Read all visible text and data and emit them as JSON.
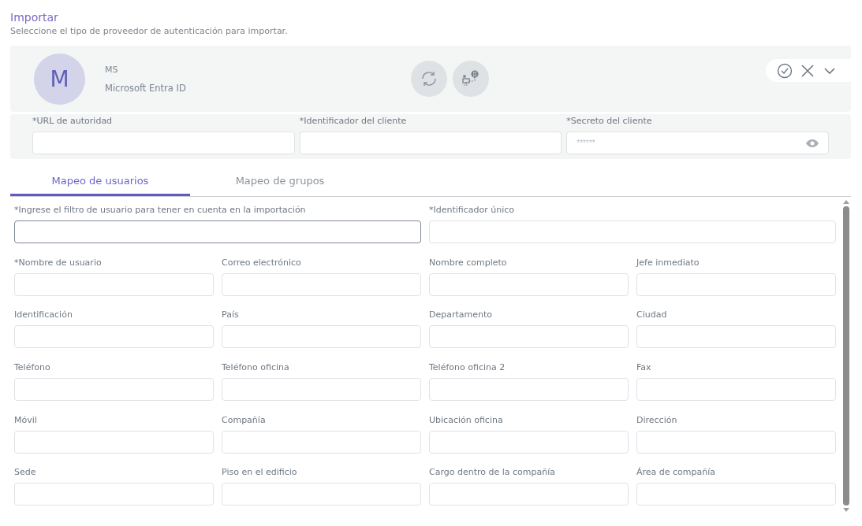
{
  "header": {
    "title": "Importar",
    "subtitle": "Seleccione el tipo de proveedor de autenticación para importar."
  },
  "provider": {
    "avatar_letter": "M",
    "code": "MS",
    "name": "Microsoft Entra ID"
  },
  "credentials": [
    {
      "label": "*URL de autoridad",
      "kind": "text"
    },
    {
      "label": "*Identificador del cliente",
      "kind": "text"
    },
    {
      "label": "*Secreto del cliente",
      "kind": "password",
      "placeholder": "******"
    }
  ],
  "tabs": [
    {
      "label": "Mapeo de usuarios",
      "selected": true
    },
    {
      "label": "Mapeo de grupos",
      "selected": false
    }
  ],
  "fields": [
    {
      "label": "*Ingrese el filtro de usuario para tener en cuenta en la importación",
      "wide": true,
      "focused": true
    },
    {
      "label": "*Identificador único",
      "wide": true,
      "focused": false
    },
    {
      "label": "*Nombre de usuario",
      "wide": false,
      "focused": false
    },
    {
      "label": "Correo electrónico",
      "wide": false,
      "focused": false
    },
    {
      "label": "Nombre completo",
      "wide": false,
      "focused": false
    },
    {
      "label": "Jefe inmediato",
      "wide": false,
      "focused": false
    },
    {
      "label": "Identificación",
      "wide": false,
      "focused": false
    },
    {
      "label": "País",
      "wide": false,
      "focused": false
    },
    {
      "label": "Departamento",
      "wide": false,
      "focused": false
    },
    {
      "label": "Ciudad",
      "wide": false,
      "focused": false
    },
    {
      "label": "Teléfono",
      "wide": false,
      "focused": false
    },
    {
      "label": "Teléfono oficina",
      "wide": false,
      "focused": false
    },
    {
      "label": "Teléfono oficina 2",
      "wide": false,
      "focused": false
    },
    {
      "label": "Fax",
      "wide": false,
      "focused": false
    },
    {
      "label": "Móvil",
      "wide": false,
      "focused": false
    },
    {
      "label": "Compañía",
      "wide": false,
      "focused": false
    },
    {
      "label": "Ubicación oficina",
      "wide": false,
      "focused": false
    },
    {
      "label": "Dirección",
      "wide": false,
      "focused": false
    },
    {
      "label": "Sede",
      "wide": false,
      "focused": false
    },
    {
      "label": "Piso en el edificio",
      "wide": false,
      "focused": false
    },
    {
      "label": "Cargo dentro de la compañía",
      "wide": false,
      "focused": false
    },
    {
      "label": "Área de compañía",
      "wide": false,
      "focused": false
    }
  ]
}
